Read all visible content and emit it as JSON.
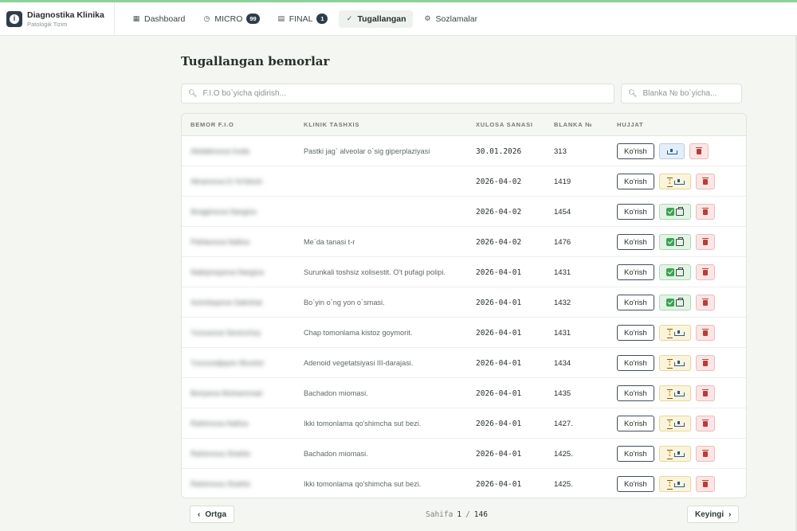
{
  "brand": {
    "title": "Diagnostika Klinika",
    "subtitle": "Patologik Tizim"
  },
  "nav": [
    {
      "label": "Dashboard",
      "icon": "grid-icon",
      "badge": ""
    },
    {
      "label": "MICRO",
      "icon": "clock-icon",
      "badge": "99"
    },
    {
      "label": "FINAL",
      "icon": "document-icon",
      "badge": "1"
    },
    {
      "label": "Tugallangan",
      "icon": "check-icon",
      "badge": "",
      "active": true
    },
    {
      "label": "Sozlamalar",
      "icon": "gear-icon",
      "badge": ""
    }
  ],
  "page": {
    "title": "Tugallangan bemorlar"
  },
  "search": {
    "fio_placeholder": "F.I.O bo`yicha qidirish...",
    "blank_placeholder": "Blanka № bo`yicha..."
  },
  "table": {
    "headers": [
      "BEMOR F.I.O",
      "KLINIK TASHXIS",
      "XULOSA SANASI",
      "BLANKA №",
      "HUJJAT"
    ],
    "view_label": "Ko'rish",
    "rows": [
      {
        "name": "Abdalimova Iroda",
        "diagnosis": "Pastki jag` alveolar o`sig giperplaziyasi",
        "date": "30.01.2026",
        "blank": "313",
        "status": "sent"
      },
      {
        "name": "Akramova D.Yo'ldosh",
        "diagnosis": "",
        "date": "2026-04-02",
        "blank": "1419",
        "status": "pending"
      },
      {
        "name": "Ibragimova Nargiza",
        "diagnosis": "",
        "date": "2026-04-02",
        "blank": "1454",
        "status": "done"
      },
      {
        "name": "Pahlavova Nafiza",
        "diagnosis": "Me`da tanasi t-r",
        "date": "2026-04-02",
        "blank": "1476",
        "status": "done"
      },
      {
        "name": "Nabiyivayeva Nargiza",
        "diagnosis": "Surunkali toshsiz xolisestit. O't pufagi polipi.",
        "date": "2026-04-01",
        "blank": "1431",
        "status": "done"
      },
      {
        "name": "Azimbayeva Sabohat",
        "diagnosis": "Bo`yin o`ng yon o`smasi.",
        "date": "2026-04-01",
        "blank": "1432",
        "status": "done"
      },
      {
        "name": "Yunusova Sevinchoy",
        "diagnosis": "Chap tomonlama kistoz goymorit.",
        "date": "2026-04-01",
        "blank": "1431",
        "status": "pending"
      },
      {
        "name": "Yusuxodjayev Muxtoir",
        "diagnosis": "Adenoid vegetatsiyasi III-darajasi.",
        "date": "2026-04-01",
        "blank": "1434",
        "status": "pending"
      },
      {
        "name": "Boriyeva Muhammad",
        "diagnosis": "Bachadon miomasi.",
        "date": "2026-04-01",
        "blank": "1435",
        "status": "pending"
      },
      {
        "name": "Rahimova Nafiza",
        "diagnosis": "Ikki tomonlama qo'shimcha sut bezi.",
        "date": "2026-04-01",
        "blank": "1427.",
        "status": "pending"
      },
      {
        "name": "Rahimova Shahlo",
        "diagnosis": "Bachadon miomasi.",
        "date": "2026-04-01",
        "blank": "1425.",
        "status": "pending"
      },
      {
        "name": "Rahimova Shahlo",
        "diagnosis": "Ikki tomonlama qo'shimcha sut bezi.",
        "date": "2026-04-01",
        "blank": "1425.",
        "status": "pending"
      }
    ]
  },
  "pager": {
    "prev": "Ortga",
    "next": "Keyingi",
    "label": "Sahifa",
    "current": "1",
    "sep": "/",
    "total": "146"
  }
}
